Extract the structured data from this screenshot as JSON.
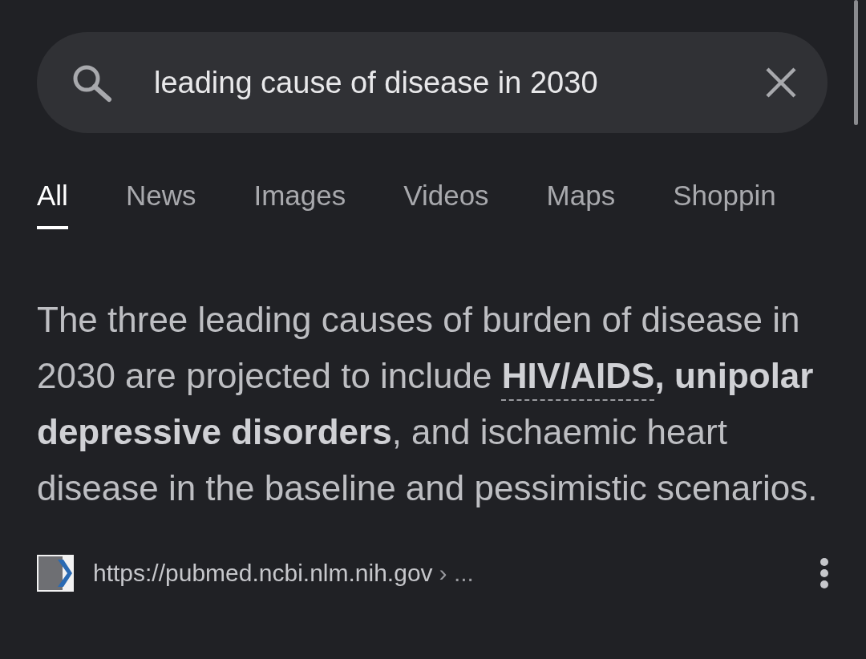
{
  "search": {
    "value": "leading cause of disease in 2030"
  },
  "tabs": [
    {
      "label": "All",
      "selected": true
    },
    {
      "label": "News",
      "selected": false
    },
    {
      "label": "Images",
      "selected": false
    },
    {
      "label": "Videos",
      "selected": false
    },
    {
      "label": "Maps",
      "selected": false
    },
    {
      "label": "Shoppin",
      "selected": false
    }
  ],
  "snippet": {
    "text_before": "The three leading causes of burden of disease in 2030 are projected to include",
    "link": "HIV/AIDS",
    "text_after": "**, unipolar depressive disorders**, and ischaemic heart disease in the baseline and pessimistic scenarios."
  },
  "source": {
    "url": "https://pubmed.ncbi.nlm.nih.gov",
    "breadcrumb": "› ..."
  }
}
